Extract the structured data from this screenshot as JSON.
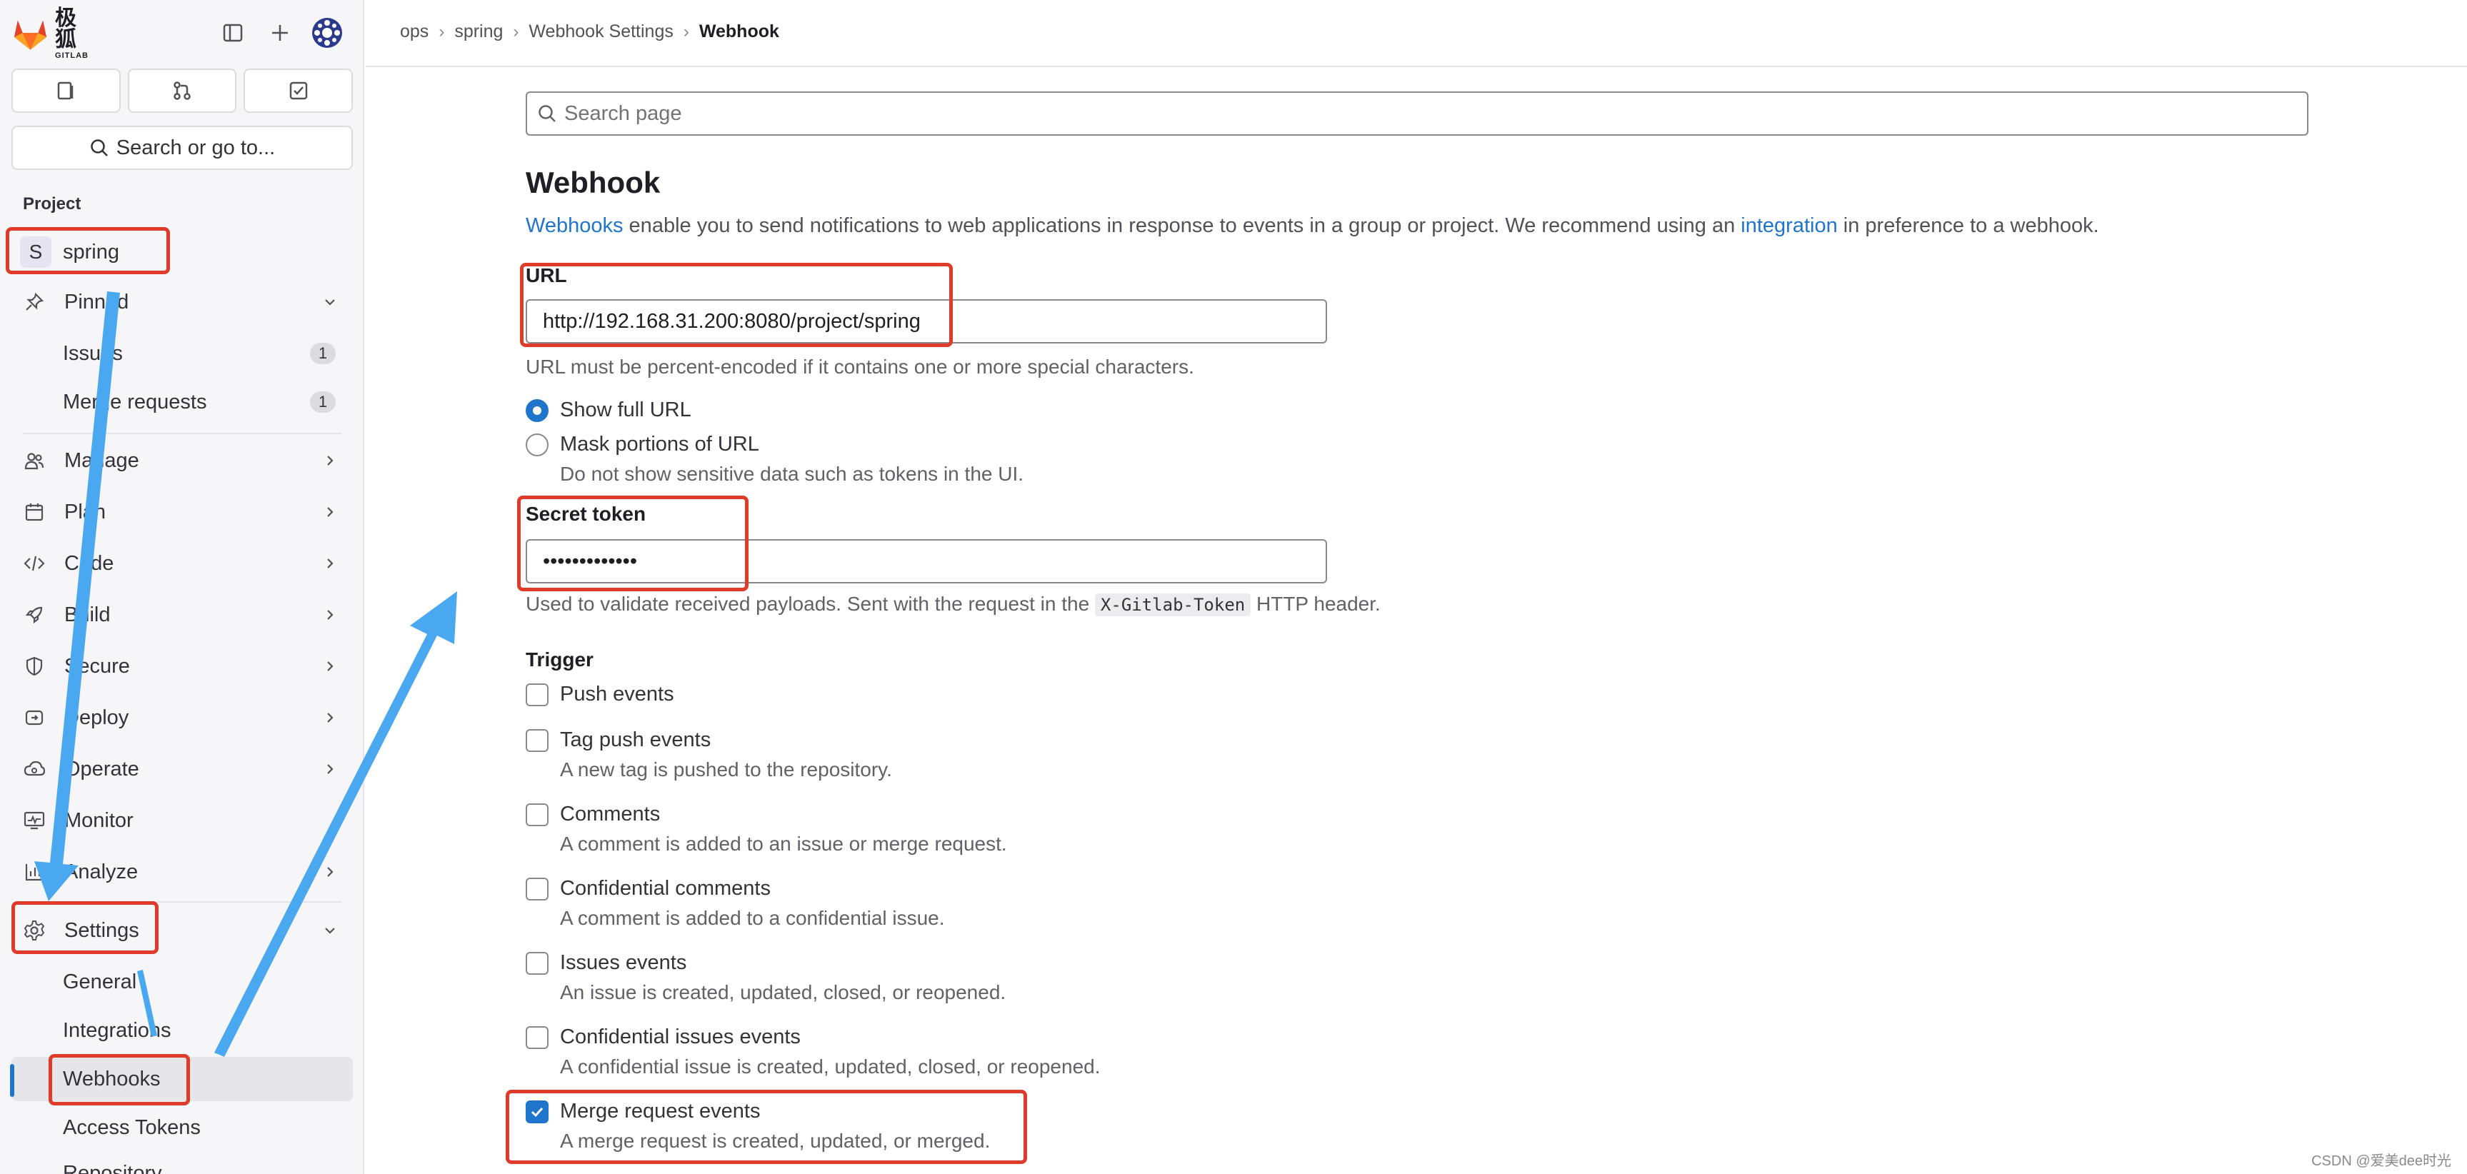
{
  "brand": {
    "name_cn": "极狐",
    "name_en": "GITLAB",
    "accent": "#1f75cb",
    "annotation_color": "#e03a2a",
    "arrow_color": "#4aa8f0"
  },
  "sidebar": {
    "search_label": "Search or go to...",
    "section_label": "Project",
    "project": {
      "avatar_letter": "S",
      "name": "spring"
    },
    "pinned": {
      "label": "Pinned",
      "items": [
        {
          "label": "Issues",
          "count": "1"
        },
        {
          "label": "Merge requests",
          "count": "1"
        }
      ]
    },
    "items": [
      {
        "label": "Manage",
        "icon": "users-icon"
      },
      {
        "label": "Plan",
        "icon": "calendar-icon"
      },
      {
        "label": "Code",
        "icon": "code-icon"
      },
      {
        "label": "Build",
        "icon": "rocket-icon"
      },
      {
        "label": "Secure",
        "icon": "shield-icon"
      },
      {
        "label": "Deploy",
        "icon": "deploy-icon"
      },
      {
        "label": "Operate",
        "icon": "cloud-icon"
      },
      {
        "label": "Monitor",
        "icon": "monitor-icon"
      },
      {
        "label": "Analyze",
        "icon": "chart-icon"
      }
    ],
    "settings": {
      "label": "Settings",
      "items": [
        {
          "label": "General"
        },
        {
          "label": "Integrations"
        },
        {
          "label": "Webhooks"
        },
        {
          "label": "Access Tokens"
        },
        {
          "label": "Repository"
        }
      ]
    }
  },
  "breadcrumb": [
    "ops",
    "spring",
    "Webhook Settings",
    "Webhook"
  ],
  "main": {
    "search_placeholder": "Search page",
    "title": "Webhook",
    "intro": {
      "link1": "Webhooks",
      "text1": " enable you to send notifications to web applications in response to events in a group or project. We recommend using an ",
      "link2": "integration",
      "text2": " in preference to a webhook."
    },
    "url": {
      "label": "URL",
      "value": "http://192.168.31.200:8080/project/spring",
      "help": "URL must be percent-encoded if it contains one or more special characters.",
      "options": [
        {
          "label": "Show full URL",
          "selected": true,
          "desc": ""
        },
        {
          "label": "Mask portions of URL",
          "selected": false,
          "desc": "Do not show sensitive data such as tokens in the UI."
        }
      ]
    },
    "secret": {
      "label": "Secret token",
      "value": "•••••••••••••",
      "help_before": "Used to validate received payloads. Sent with the request in the ",
      "help_code": "X-Gitlab-Token",
      "help_after": " HTTP header."
    },
    "trigger": {
      "label": "Trigger",
      "events": [
        {
          "label": "Push events",
          "desc": "",
          "checked": false
        },
        {
          "label": "Tag push events",
          "desc": "A new tag is pushed to the repository.",
          "checked": false
        },
        {
          "label": "Comments",
          "desc": "A comment is added to an issue or merge request.",
          "checked": false
        },
        {
          "label": "Confidential comments",
          "desc": "A comment is added to a confidential issue.",
          "checked": false
        },
        {
          "label": "Issues events",
          "desc": "An issue is created, updated, closed, or reopened.",
          "checked": false
        },
        {
          "label": "Confidential issues events",
          "desc": "A confidential issue is created, updated, closed, or reopened.",
          "checked": false
        },
        {
          "label": "Merge request events",
          "desc": "A merge request is created, updated, or merged.",
          "checked": true
        }
      ]
    }
  },
  "watermark": "CSDN @爱美dee时光"
}
